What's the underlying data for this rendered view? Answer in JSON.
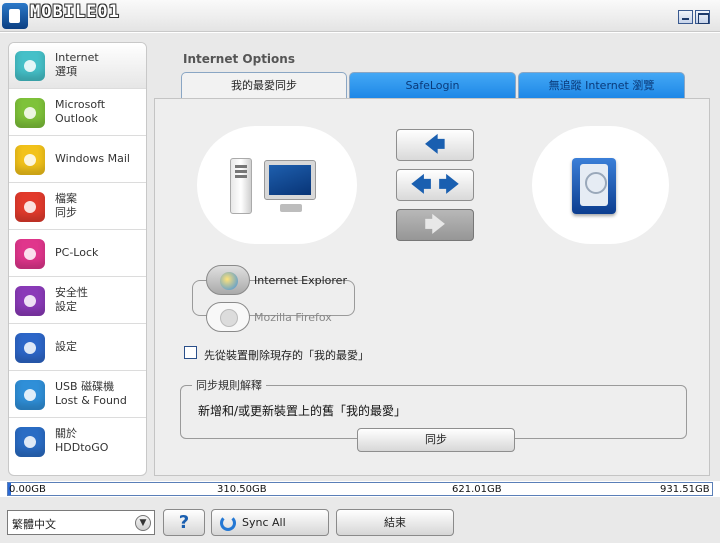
{
  "titlebar": {
    "watermark": "MOBILE01"
  },
  "sidebar": {
    "items": [
      {
        "label": "Internet\n選項",
        "icon": "internet-options-icon",
        "color": "#45c0c8"
      },
      {
        "label": "Microsoft\nOutlook",
        "icon": "outlook-icon",
        "color": "#7ec23a"
      },
      {
        "label": "Windows Mail",
        "icon": "windows-mail-icon",
        "color": "#f2c21a"
      },
      {
        "label": "檔案\n同步",
        "icon": "file-sync-icon",
        "color": "#e23a2c"
      },
      {
        "label": "PC-Lock",
        "icon": "key-icon",
        "color": "#e0368c"
      },
      {
        "label": "安全性\n設定",
        "icon": "lock-icon",
        "color": "#8a3ab8"
      },
      {
        "label": "設定",
        "icon": "gear-icon",
        "color": "#2d66c8"
      },
      {
        "label": "USB 磁碟機\nLost & Found",
        "icon": "magnifier-icon",
        "color": "#2f8fd8"
      },
      {
        "label": "關於\nHDDtoGO",
        "icon": "briefcase-icon",
        "color": "#2a6cc4"
      }
    ]
  },
  "header": {
    "title": "Internet Options"
  },
  "tabs": [
    {
      "label": "我的最愛同步"
    },
    {
      "label": "SafeLogin"
    },
    {
      "label": "無追蹤 Internet 瀏覽"
    }
  ],
  "browsers": {
    "ie": "Internet Explorer",
    "firefox": "Mozilla Firefox"
  },
  "checkbox": {
    "label": "先從裝置刪除現存的「我的最愛」"
  },
  "rules": {
    "legend": "同步規則解釋",
    "text": "新增和/或更新裝置上的舊「我的最愛」",
    "sync_button": "同步"
  },
  "capacity": {
    "used_fraction": 0.004,
    "labels": [
      "0.00GB",
      "310.50GB",
      "621.01GB",
      "931.51GB"
    ]
  },
  "bottom": {
    "language": "繁體中文",
    "help": "?",
    "sync_all": "Sync All",
    "exit": "結束"
  },
  "colors": {
    "accent": "#1c86e6",
    "capacity_fill": "#2b6ad6"
  }
}
